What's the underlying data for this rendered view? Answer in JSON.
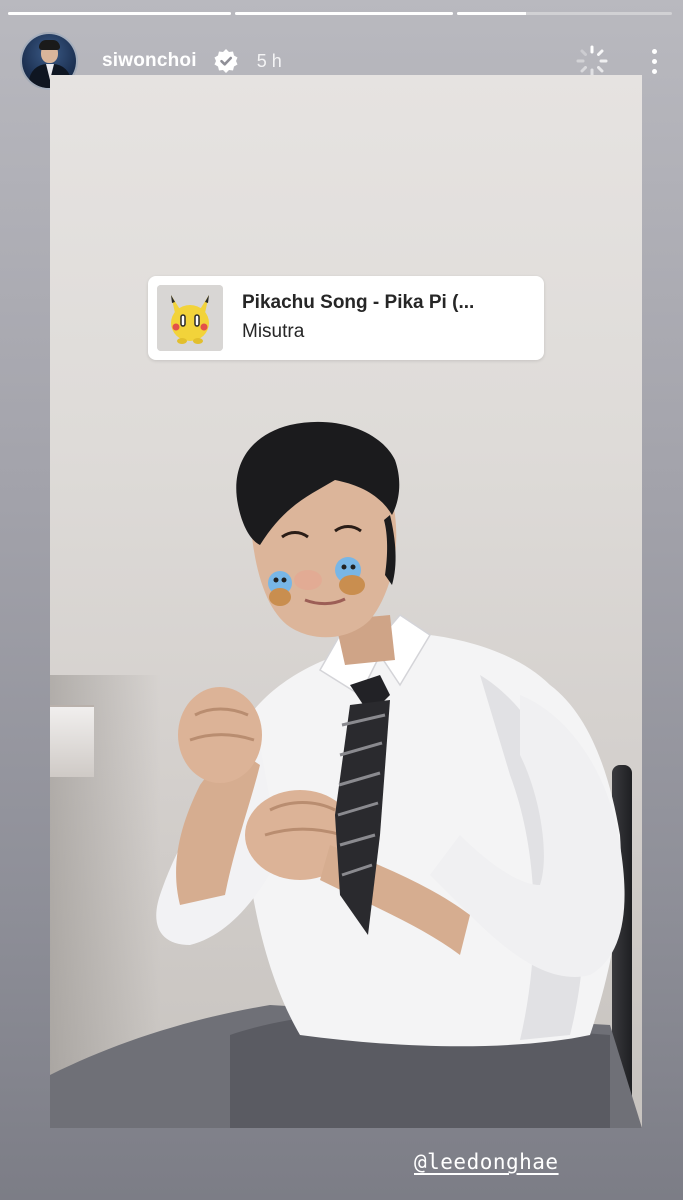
{
  "story": {
    "progress": [
      1.0,
      1.0,
      0.32
    ],
    "username": "siwonchoi",
    "verified_icon": "verified-badge-icon",
    "time_ago": "5 h",
    "loading_icon": "loading-spinner-icon",
    "more_icon": "more-options-icon"
  },
  "music_sticker": {
    "title": "Pikachu Song - Pika Pi (...",
    "artist": "Misutra",
    "album_icon": "pikachu-album-art"
  },
  "mention": {
    "text": "@leedonghae"
  },
  "colors": {
    "background_top": "#b9b9bf",
    "background_bottom": "#7c7d86",
    "sticker_bg": "#ffffff",
    "text_primary": "#262626",
    "pikachu_yellow": "#f2d33a"
  }
}
